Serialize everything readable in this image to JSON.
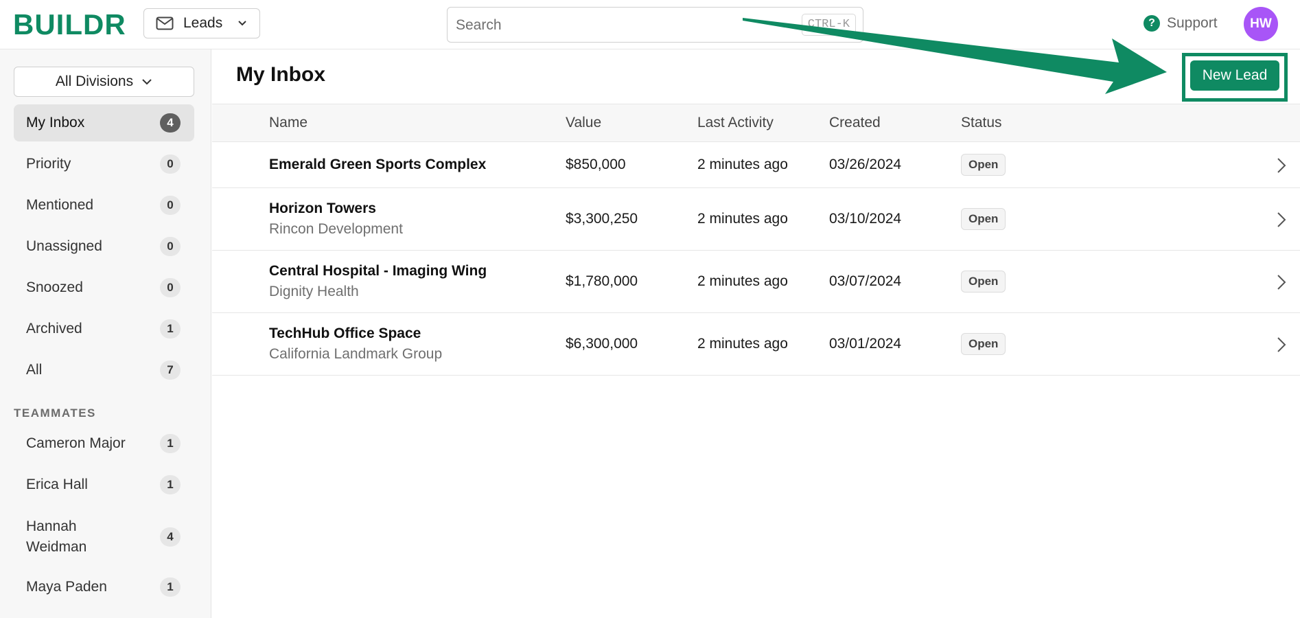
{
  "header": {
    "logo": "BUILDR",
    "module": "Leads",
    "search_placeholder": "Search",
    "search_shortcut": "CTRL-K",
    "support": "Support",
    "avatar_initials": "HW"
  },
  "sidebar": {
    "division": "All Divisions",
    "items": [
      {
        "label": "My Inbox",
        "count": "4"
      },
      {
        "label": "Priority",
        "count": "0"
      },
      {
        "label": "Mentioned",
        "count": "0"
      },
      {
        "label": "Unassigned",
        "count": "0"
      },
      {
        "label": "Snoozed",
        "count": "0"
      },
      {
        "label": "Archived",
        "count": "1"
      },
      {
        "label": "All",
        "count": "7"
      }
    ],
    "teammates_label": "TEAMMATES",
    "teammates": [
      {
        "label": "Cameron Major",
        "count": "1"
      },
      {
        "label": "Erica Hall",
        "count": "1"
      },
      {
        "label": "Hannah Weidman",
        "count": "4"
      },
      {
        "label": "Maya Paden",
        "count": "1"
      }
    ]
  },
  "main": {
    "title": "My Inbox",
    "new_lead_label": "New Lead",
    "columns": [
      "Name",
      "Value",
      "Last Activity",
      "Created",
      "Status"
    ],
    "rows": [
      {
        "name": "Emerald Green Sports Complex",
        "company": "",
        "value": "$850,000",
        "activity": "2 minutes ago",
        "created": "03/26/2024",
        "status": "Open"
      },
      {
        "name": "Horizon Towers",
        "company": "Rincon Development",
        "value": "$3,300,250",
        "activity": "2 minutes ago",
        "created": "03/10/2024",
        "status": "Open"
      },
      {
        "name": "Central Hospital - Imaging Wing",
        "company": "Dignity Health",
        "value": "$1,780,000",
        "activity": "2 minutes ago",
        "created": "03/07/2024",
        "status": "Open"
      },
      {
        "name": "TechHub Office Space",
        "company": "California Landmark Group",
        "value": "$6,300,000",
        "activity": "2 minutes ago",
        "created": "03/01/2024",
        "status": "Open"
      }
    ]
  },
  "colors": {
    "brand": "#0f8a62",
    "avatar": "#a855f7"
  }
}
